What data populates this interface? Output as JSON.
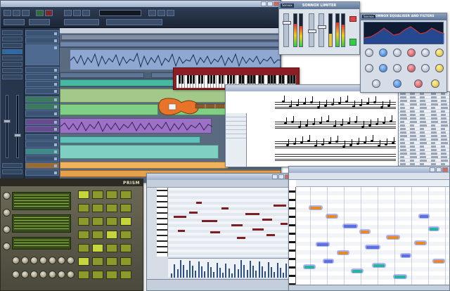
{
  "colors": {
    "ui_dark_blue": "#1f2a38",
    "clip_blue": "#6f8fc0",
    "clip_teal": "#3db3a8",
    "clip_purple": "#8b63b8",
    "clip_orange": "#e39a45",
    "clip_green": "#6bbd5f",
    "keyboard_red": "#8c1d24",
    "synth_olive": "#6d6a58",
    "vari_orange": "#e58a2a",
    "vari_blue": "#5a6fe0",
    "vari_teal": "#27b3a2"
  },
  "limiter": {
    "brand": "Sonnox",
    "title": "SONNOX LIMITER"
  },
  "eq": {
    "brand": "Sonnox",
    "title": "SONNOX EQUALISER AND FILTERS"
  },
  "synth": {
    "logo": "PRISM"
  },
  "icons": [
    "minimize-icon",
    "maximize-icon",
    "close-icon",
    "play-icon",
    "record-icon",
    "guitar-icon",
    "keyboard-icon"
  ]
}
